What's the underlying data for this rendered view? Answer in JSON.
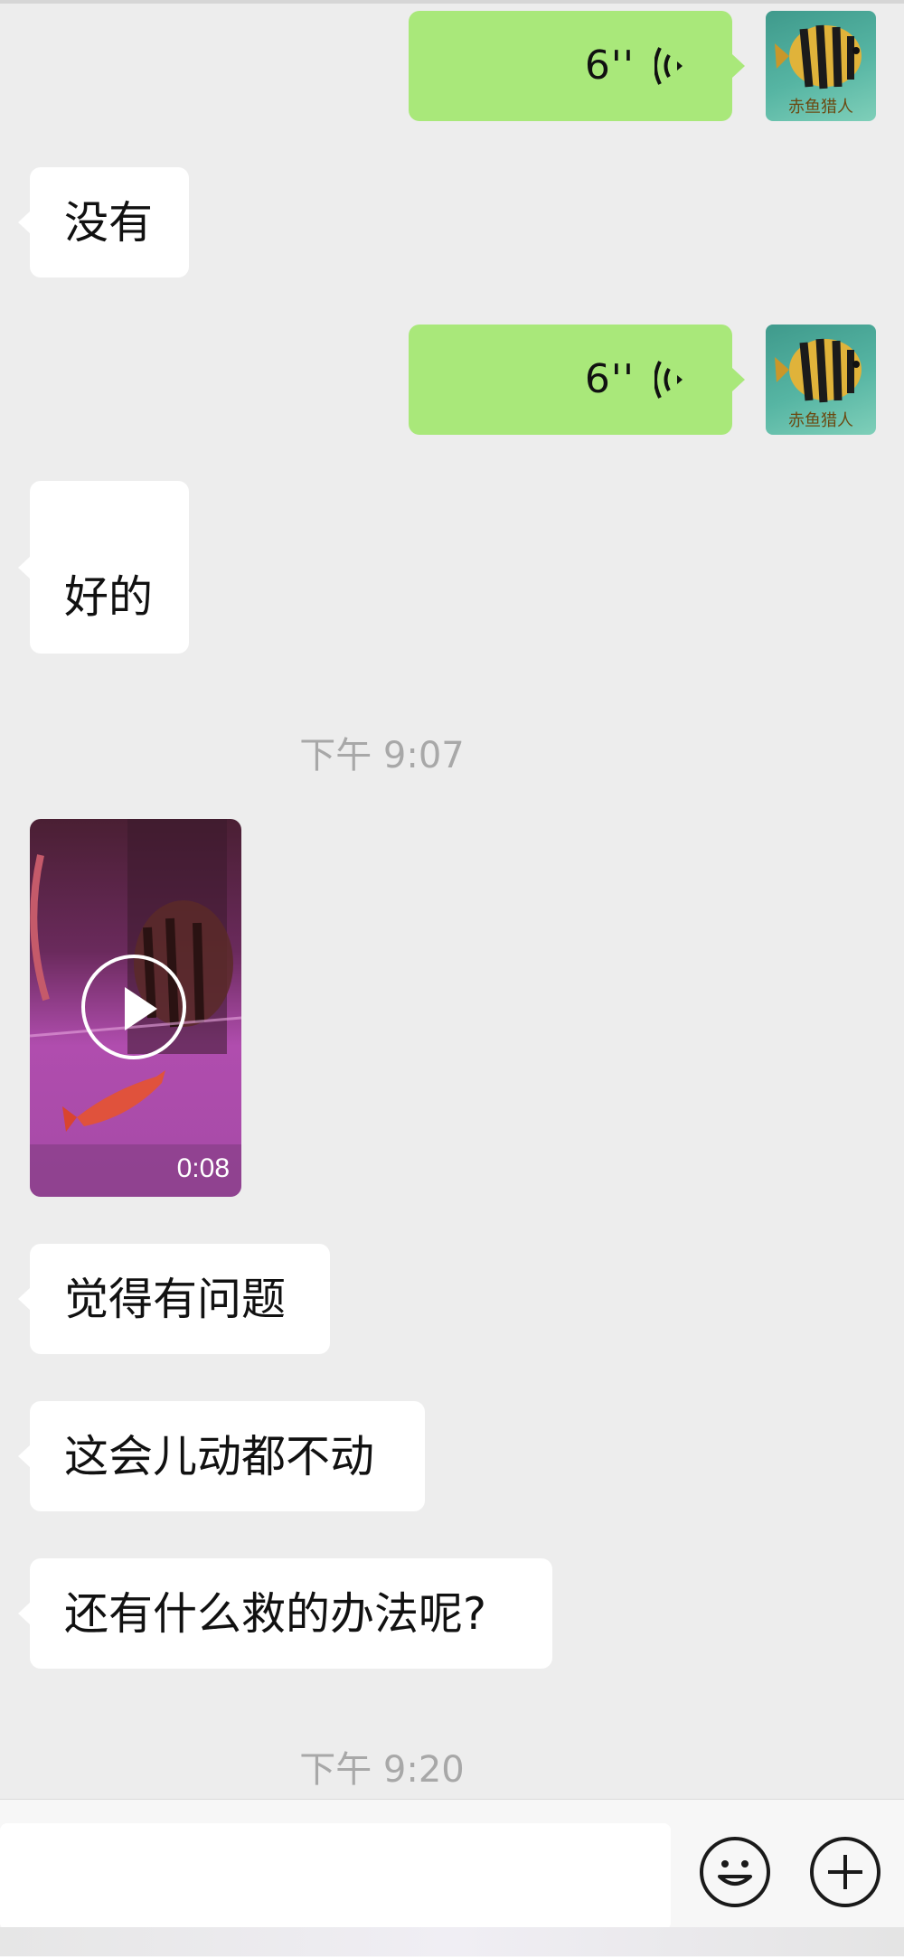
{
  "chat": {
    "voice1": {
      "duration": "6''"
    },
    "msg1": "没有",
    "voice2": {
      "duration": "6''"
    },
    "msg2": "好的",
    "time1": "下午 9:07",
    "video": {
      "duration": "0:08"
    },
    "msg3": "觉得有问题",
    "msg4": "这会儿动都不动",
    "msg5": "还有什么救的办法呢?",
    "time2": "下午 9:20",
    "avatar_caption": "赤鱼猎人"
  },
  "colors": {
    "background": "#ededed",
    "outgoing_bubble": "#a9e87a",
    "incoming_bubble": "#ffffff",
    "timestamp": "#a8a8a8"
  },
  "icons": {
    "voice": "voice-wave-icon",
    "play": "play-icon",
    "emoji": "smiley-face-icon",
    "more": "plus-icon"
  }
}
